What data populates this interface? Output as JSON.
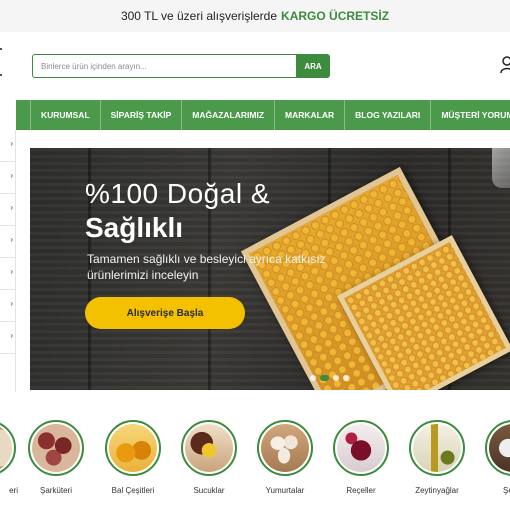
{
  "promo": {
    "text": "300 TL ve üzeri alışverişlerde",
    "highlight": "KARGO ÜCRETSİZ"
  },
  "search": {
    "placeholder": "Binlerce ürün içinden arayın...",
    "button_label": "ARA"
  },
  "nav": {
    "items": [
      "KURUMSAL",
      "SİPARİŞ TAKİP",
      "MAĞAZALARIMIZ",
      "MARKALAR",
      "BLOG YAZILARI",
      "MÜŞTERİ YORUMLARI"
    ]
  },
  "category_menu": {
    "arrow": "›",
    "rows": 7
  },
  "banner": {
    "title_line1": "%100 Doğal &",
    "title_line2": "Sağlıklı",
    "description": "Tamamen sağlıklı ve besleyici ayrıca katkısız ürünlerimizi inceleyin",
    "button_label": "Alışverişe Başla",
    "slides": 3,
    "active_slide": 1
  },
  "categories": [
    {
      "label": "eri",
      "icon": "partial-category-image"
    },
    {
      "label": "Şarküteri",
      "icon": "charcuterie-image"
    },
    {
      "label": "Bal Çeşitleri",
      "icon": "honey-image"
    },
    {
      "label": "Sucuklar",
      "icon": "sausage-image"
    },
    {
      "label": "Yumurtalar",
      "icon": "eggs-image"
    },
    {
      "label": "Reçeller",
      "icon": "jam-image"
    },
    {
      "label": "Zeytinyağlar",
      "icon": "olive-oil-image"
    },
    {
      "label": "Şeker",
      "icon": "sugar-image"
    }
  ],
  "colors": {
    "brand_green": "#3d8b3d",
    "nav_green": "#4b9a4b",
    "button_yellow": "#f3c100"
  }
}
